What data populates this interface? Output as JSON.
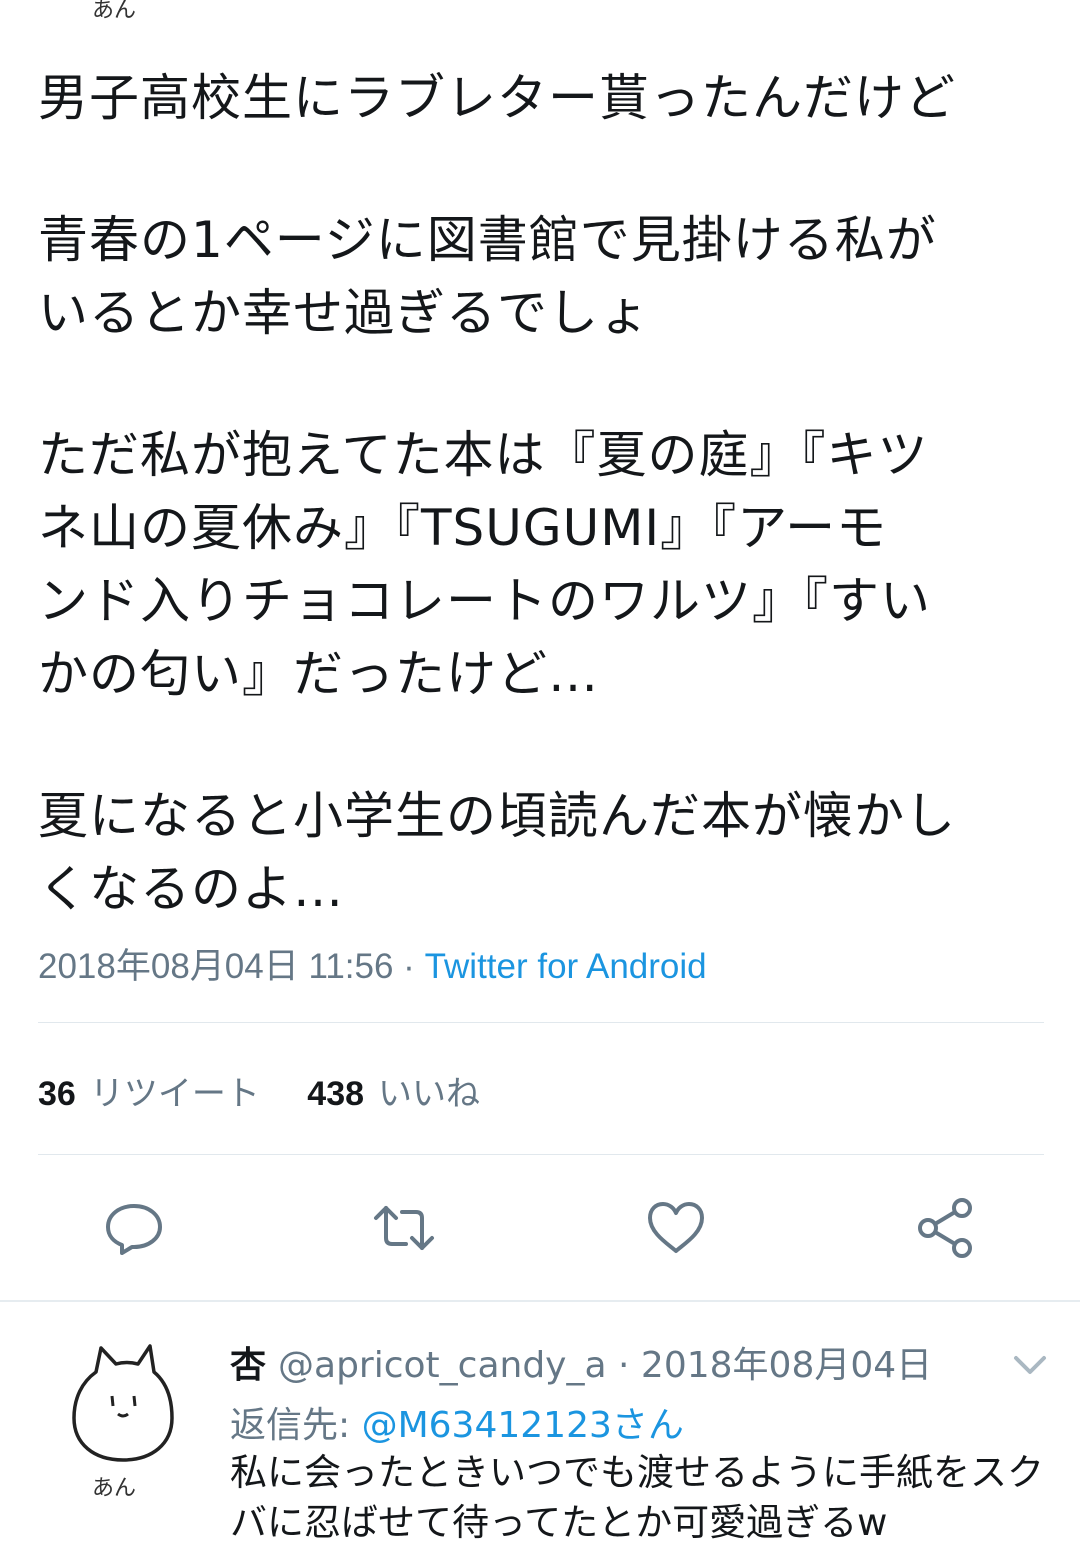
{
  "top_avatar_label": "あん",
  "tweet": {
    "paragraphs": [
      "男子高校生にラブレター貰ったんだけど",
      "青春の1ページに図書館で見掛ける私が\nいるとか幸せ過ぎるでしょ",
      "ただ私が抱えてた本は『夏の庭』『キツ\nネ山の夏休み』『TSUGUMI』『アーモ\nンド入りチョコレートのワルツ』『すい\nかの匂い』だったけど…",
      "夏になると小学生の頃読んだ本が懐かし\nくなるのよ…"
    ],
    "timestamp": "2018年08月04日 11:56",
    "separator": "·",
    "source": "Twitter for Android"
  },
  "stats": {
    "retweet_count": "36",
    "retweet_label": "リツイート",
    "like_count": "438",
    "like_label": "いいね"
  },
  "actions": {
    "reply_icon": "reply-icon",
    "retweet_icon": "retweet-icon",
    "like_icon": "heart-icon",
    "share_icon": "share-icon"
  },
  "reply": {
    "avatar_label": "あん",
    "name": "杏",
    "handle": "@apricot_candy_a",
    "separator": "·",
    "date": "2018年08月04日",
    "reply_to_label": "返信先:",
    "reply_to_mention": "@M63412123さん",
    "text": "私に会ったときいつでも渡せるように手紙をスクバに忍ばせて待ってたとか可愛過ぎるw"
  },
  "colors": {
    "text": "#14171a",
    "secondary": "#657786",
    "link": "#1b95e0",
    "divider": "#e1e8ed"
  }
}
